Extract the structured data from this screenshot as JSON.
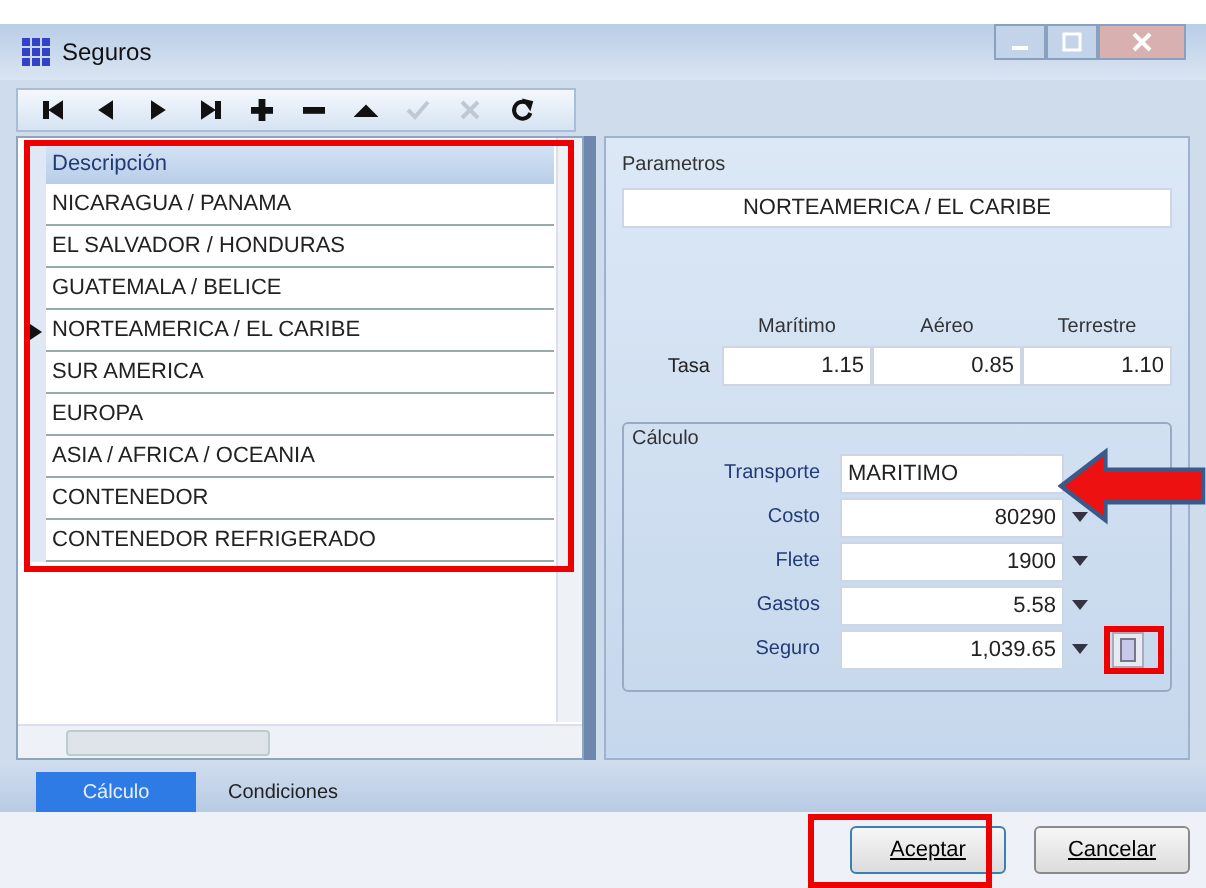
{
  "window": {
    "title": "Seguros"
  },
  "toolbar": [
    {
      "kind": "first",
      "disabled": false
    },
    {
      "kind": "prev",
      "disabled": false
    },
    {
      "kind": "next",
      "disabled": false
    },
    {
      "kind": "last",
      "disabled": false
    },
    {
      "kind": "add",
      "disabled": false
    },
    {
      "kind": "remove",
      "disabled": false
    },
    {
      "kind": "edit",
      "disabled": false
    },
    {
      "kind": "accept",
      "disabled": true
    },
    {
      "kind": "cancel",
      "disabled": true
    },
    {
      "kind": "refresh",
      "disabled": false
    }
  ],
  "grid": {
    "header": "Descripción",
    "rows": [
      {
        "text": "NICARAGUA / PANAMA",
        "current": false
      },
      {
        "text": "EL SALVADOR / HONDURAS",
        "current": false
      },
      {
        "text": "GUATEMALA / BELICE",
        "current": false
      },
      {
        "text": "NORTEAMERICA / EL CARIBE",
        "current": true
      },
      {
        "text": "SUR AMERICA",
        "current": false
      },
      {
        "text": "EUROPA",
        "current": false
      },
      {
        "text": "ASIA / AFRICA / OCEANIA",
        "current": false
      },
      {
        "text": "CONTENEDOR",
        "current": false
      },
      {
        "text": "CONTENEDOR REFRIGERADO",
        "current": false
      }
    ]
  },
  "parameters": {
    "label": "Parametros",
    "value": "NORTEAMERICA / EL CARIBE",
    "column_headers": [
      "Marítimo",
      "Aéreo",
      "Terrestre"
    ],
    "rate_label": "Tasa",
    "rates": [
      "1.15",
      "0.85",
      "1.10"
    ]
  },
  "calculation": {
    "label": "Cálculo",
    "fields": [
      {
        "label": "Transporte",
        "value": "MARITIMO",
        "kind": "text"
      },
      {
        "label": "Costo",
        "value": "80290",
        "kind": "spin"
      },
      {
        "label": "Flete",
        "value": "1900",
        "kind": "spin"
      },
      {
        "label": "Gastos",
        "value": "5.58",
        "kind": "spin"
      },
      {
        "label": "Seguro",
        "value": "1,039.65",
        "kind": "spin_button"
      }
    ]
  },
  "tabs": [
    {
      "label": "Cálculo",
      "selected": true
    },
    {
      "label": "Condiciones",
      "selected": false
    }
  ],
  "buttons": [
    "Aceptar",
    "Cancelar"
  ]
}
